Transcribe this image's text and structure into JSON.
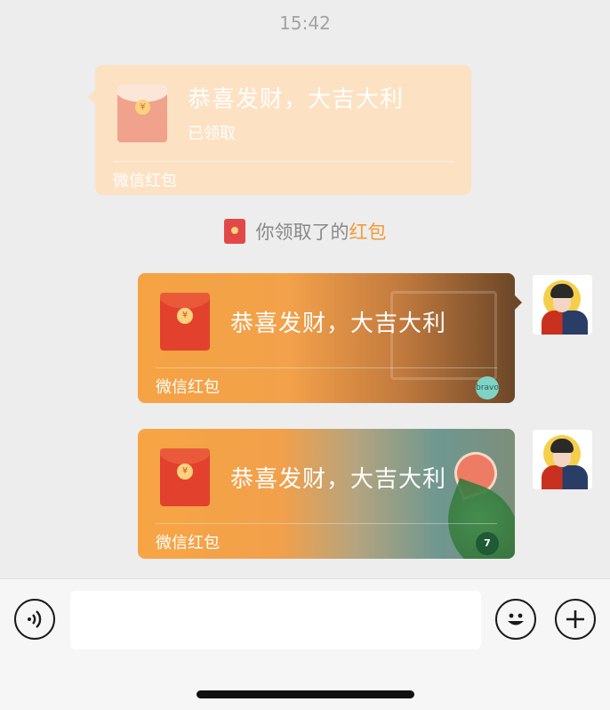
{
  "status": {
    "time": "15:42"
  },
  "chat": {
    "received_packet": {
      "title": "恭喜发财，大吉大利",
      "status": "已领取",
      "footer": "微信红包"
    },
    "notice": {
      "text": "你领取了的",
      "link": "红包"
    },
    "sent_packets": [
      {
        "title": "恭喜发财，大吉大利",
        "footer": "微信红包",
        "badge": "bravo"
      },
      {
        "title": "恭喜发财，大吉大利",
        "footer": "微信红包",
        "badge": "7"
      }
    ]
  },
  "input_bar": {
    "placeholder": "",
    "voice_icon": "voice-icon",
    "emoji_icon": "emoji-icon",
    "plus_icon": "plus-icon"
  },
  "colors": {
    "background": "#ededed",
    "opened_packet": "#fde1c3",
    "packet_red": "#e1412d",
    "notice_link": "#f39a3a"
  }
}
